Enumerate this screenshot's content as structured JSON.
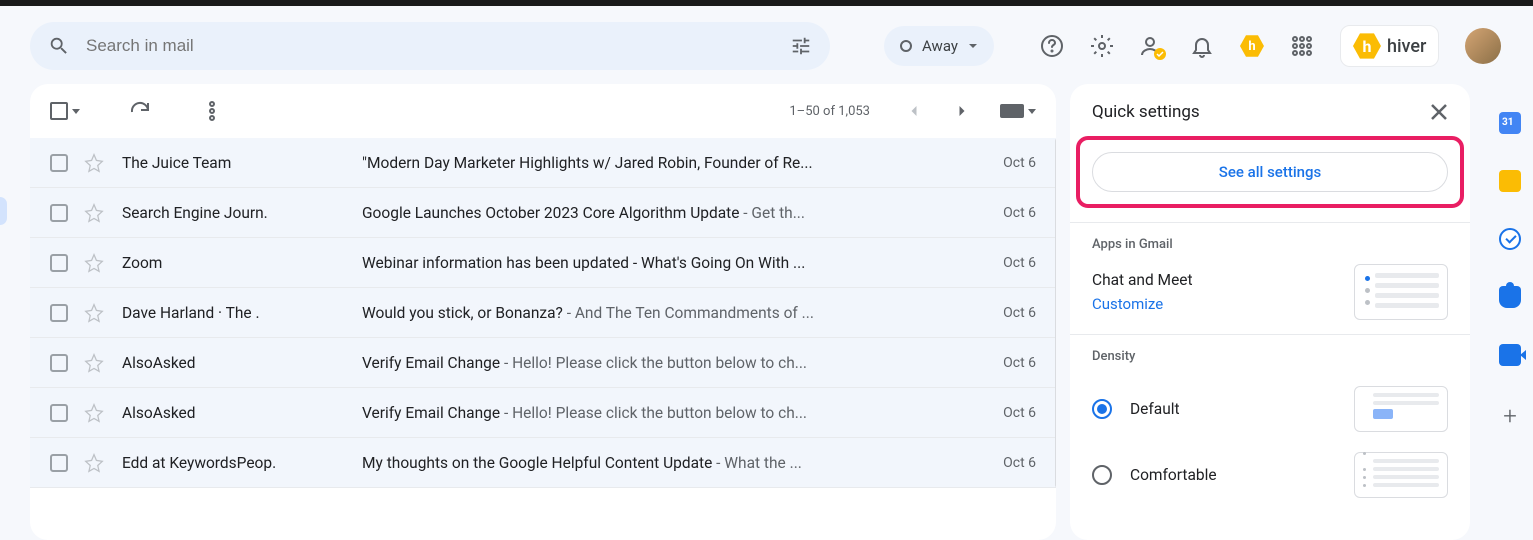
{
  "search": {
    "placeholder": "Search in mail"
  },
  "status": {
    "away_label": "Away"
  },
  "brand": {
    "hiver": "hiver"
  },
  "toolbar": {
    "page_range": "1–50 of 1,053"
  },
  "quick_settings": {
    "title": "Quick settings",
    "see_all": "See all settings",
    "apps_title": "Apps in Gmail",
    "chat_meet": "Chat and Meet",
    "customize": "Customize",
    "density_title": "Density",
    "density_options": [
      {
        "label": "Default",
        "checked": true
      },
      {
        "label": "Comfortable",
        "checked": false
      }
    ]
  },
  "emails": [
    {
      "sender": "The Juice Team",
      "subject": "\"Modern Day Marketer Highlights w/ Jared Robin, Founder of Re...",
      "snippet": "",
      "date": "Oct 6"
    },
    {
      "sender": "Search Engine Journ.",
      "subject": "Google Launches October 2023 Core Algorithm Update",
      "snippet": " - Get th...",
      "date": "Oct 6"
    },
    {
      "sender": "Zoom",
      "subject": "Webinar information has been updated - What's Going On With ...",
      "snippet": "",
      "date": "Oct 6"
    },
    {
      "sender": "Dave Harland · The .",
      "subject": "Would you stick, or Bonanza?",
      "snippet": " - And The Ten Commandments of ...",
      "date": "Oct 6"
    },
    {
      "sender": "AlsoAsked",
      "subject": "Verify Email Change",
      "snippet": " - Hello! Please click the button below to ch...",
      "date": "Oct 6"
    },
    {
      "sender": "AlsoAsked",
      "subject": "Verify Email Change",
      "snippet": " - Hello! Please click the button below to ch...",
      "date": "Oct 6"
    },
    {
      "sender": "Edd at KeywordsPeop.",
      "subject": "My thoughts on the Google Helpful Content Update",
      "snippet": " - What the ...",
      "date": "Oct 6"
    }
  ]
}
